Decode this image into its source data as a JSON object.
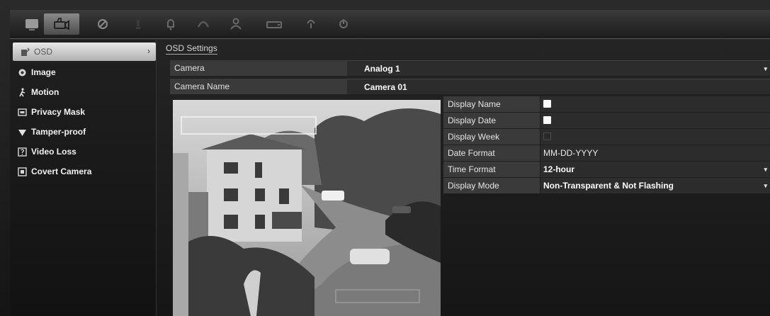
{
  "toolbar": {
    "icons": [
      "monitor-icon",
      "camera-icon",
      "record-icon",
      "bulb-icon",
      "alarm-icon",
      "globe-icon",
      "user-icon",
      "hdd-icon",
      "info-icon",
      "power-icon"
    ],
    "active_index": 1
  },
  "sidebar": {
    "items": [
      {
        "label": "OSD",
        "icon": "osd-icon"
      },
      {
        "label": "Image",
        "icon": "image-icon"
      },
      {
        "label": "Motion",
        "icon": "motion-icon"
      },
      {
        "label": "Privacy Mask",
        "icon": "privacy-mask-icon"
      },
      {
        "label": "Tamper-proof",
        "icon": "tamper-icon"
      },
      {
        "label": "Video Loss",
        "icon": "video-loss-icon"
      },
      {
        "label": "Covert Camera",
        "icon": "covert-camera-icon"
      }
    ],
    "active_index": 0
  },
  "main": {
    "section_title": "OSD Settings",
    "camera_label": "Camera",
    "camera_value": "Analog 1",
    "camera_name_label": "Camera Name",
    "camera_name_value": "Camera 01"
  },
  "settings": {
    "display_name": {
      "label": "Display Name",
      "checked": true
    },
    "display_date": {
      "label": "Display Date",
      "checked": true
    },
    "display_week": {
      "label": "Display Week",
      "checked": false
    },
    "date_format": {
      "label": "Date Format",
      "value": "MM-DD-YYYY"
    },
    "time_format": {
      "label": "Time Format",
      "value": "12-hour"
    },
    "display_mode": {
      "label": "Display Mode",
      "value": "Non-Transparent & Not Flashing"
    }
  },
  "colors": {
    "background": "#151515",
    "active_tab": "#8a8a8a",
    "label_bg": "#3a3a3a",
    "value_bg": "#2c2c2c"
  }
}
